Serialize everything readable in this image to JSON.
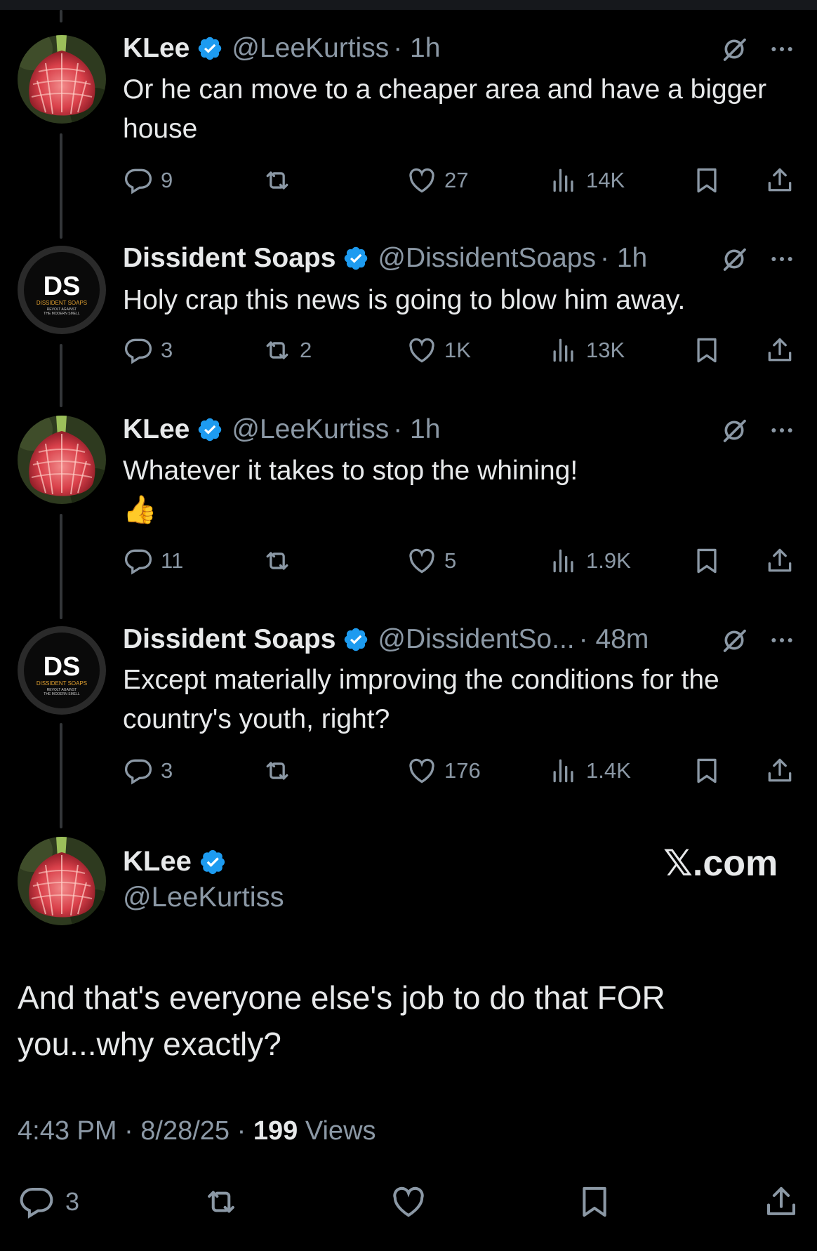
{
  "tweets": [
    {
      "name": "KLee",
      "handle": "@LeeKurtiss",
      "time": "· 1h",
      "avatar": "flower-avatar",
      "text": "Or he can move to a cheaper area and have a bigger house",
      "replies": "9",
      "retweets": "",
      "likes": "27",
      "views": "14K"
    },
    {
      "name": "Dissident Soaps",
      "handle": "@DissidentSoaps",
      "time": "· 1h",
      "avatar": "ds-avatar",
      "text": "Holy crap this news is going to blow him away.",
      "replies": "3",
      "retweets": "2",
      "likes": "1K",
      "views": "13K"
    },
    {
      "name": "KLee",
      "handle": "@LeeKurtiss",
      "time": "· 1h",
      "avatar": "flower-avatar",
      "text": "Whatever it takes to stop the whining!\n👍",
      "replies": "11",
      "retweets": "",
      "likes": "5",
      "views": "1.9K"
    },
    {
      "name": "Dissident Soaps",
      "handle": "@DissidentSo...",
      "time": "· 48m",
      "avatar": "ds-avatar",
      "text": "Except materially improving the conditions for the country's youth, right?",
      "replies": "3",
      "retweets": "",
      "likes": "176",
      "views": "1.4K"
    }
  ],
  "ds_logo": {
    "initials": "DS",
    "brand": "DISSIDENT SOAPS",
    "tagline1": "REVOLT AGAINST",
    "tagline2": "THE MODERN SMELL"
  },
  "main_tweet": {
    "name": "KLee",
    "handle": "@LeeKurtiss",
    "watermark": "𝕏.com",
    "text": "And that's everyone else's job to do that FOR you...why exactly?",
    "time": "4:43 PM · 8/28/25 ·",
    "views_count": "199",
    "views_label": "Views",
    "replies": "3"
  },
  "colors": {
    "background": "#000000",
    "verified": "#1d9bf0",
    "secondary_text": "#8b98a5"
  }
}
